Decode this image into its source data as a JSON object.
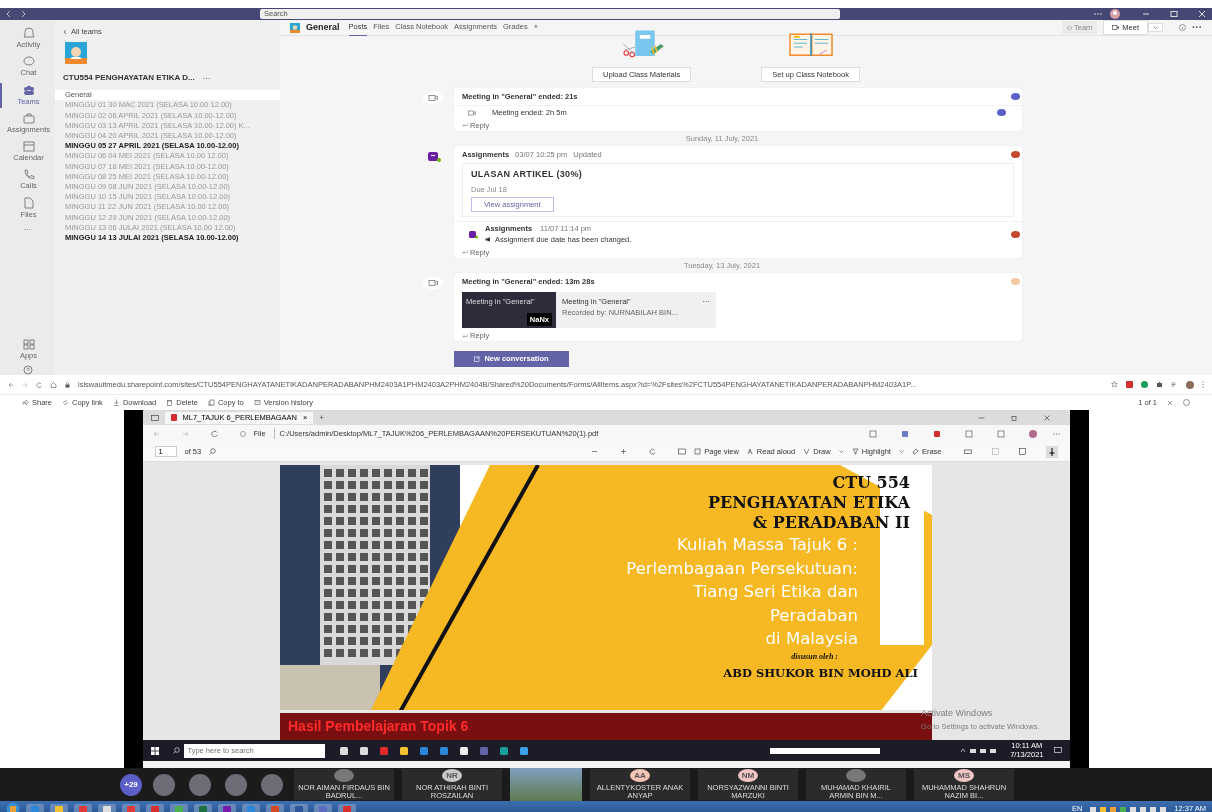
{
  "teams": {
    "search": {
      "placeholder": "Search"
    },
    "rail": [
      {
        "label": "Activity",
        "selected": false
      },
      {
        "label": "Chat",
        "selected": false
      },
      {
        "label": "Teams",
        "selected": true
      },
      {
        "label": "Assignments",
        "selected": false
      },
      {
        "label": "Calendar",
        "selected": false
      },
      {
        "label": "Calls",
        "selected": false
      },
      {
        "label": "Files",
        "selected": false
      }
    ],
    "rail_more": "···",
    "rail_bottom": [
      {
        "label": "Apps"
      }
    ],
    "back": "All teams",
    "team_name": "CTU554 PENGHAYATAN ETIKA D...",
    "team_more": "···",
    "channels": [
      {
        "name": "General",
        "selected": true,
        "unread": false
      },
      {
        "name": "MINGGU 01 30 MAC 2021 (SELASA 10.00 12.00)",
        "selected": false,
        "unread": false
      },
      {
        "name": "MINGGU 02 06 APRIL 2021 (SELASA 10.00-12.00)",
        "selected": false,
        "unread": false
      },
      {
        "name": "MINGGU 03 13 APRIL 2021 (SELASA 10.00-12.00) K...",
        "selected": false,
        "unread": false
      },
      {
        "name": "MINGGU 04 20 APRIL 2021 (SELASA 10.00-12.00)",
        "selected": false,
        "unread": false
      },
      {
        "name": "MINGGU 05 27 APRIL 2021 (SELASA 10.00-12.00)",
        "selected": false,
        "unread": true
      },
      {
        "name": "MINGGU 06 04 MEI 2021 (SELASA 10.00 12.00)",
        "selected": false,
        "unread": false
      },
      {
        "name": "MINGGU 07 18 MEI 2021 (SELASA 10.00-12.00)",
        "selected": false,
        "unread": false
      },
      {
        "name": "MINGGU 08 25 MEI 2021 (SELASA 10.00-12.00)",
        "selected": false,
        "unread": false
      },
      {
        "name": "MINGGU 09 08 JUN 2021 (SELASA 10.00-12.00)",
        "selected": false,
        "unread": false
      },
      {
        "name": "MINGGU 10 15 JUN 2021 (SELASA 10.00-12.00)",
        "selected": false,
        "unread": false
      },
      {
        "name": "MINGGU 11 22 JUN 2021 (SELASA 10.00 12.00)",
        "selected": false,
        "unread": false
      },
      {
        "name": "MINGGU 12 29 JUN 2021 (SELASA 10.00-12.00)",
        "selected": false,
        "unread": false
      },
      {
        "name": "MINGGU 13 06 JULAI 2021 (SELASA 10.00 12.00)",
        "selected": false,
        "unread": false
      },
      {
        "name": "MINGGU 14 13 JULAI 2021 (SELASA 10.00-12.00)",
        "selected": false,
        "unread": true
      }
    ],
    "channel_title": "General",
    "tabs": [
      {
        "label": "Posts",
        "selected": true
      },
      {
        "label": "Files",
        "selected": false
      },
      {
        "label": "Class Notebook",
        "selected": false
      },
      {
        "label": "Assignments",
        "selected": false
      },
      {
        "label": "Grades",
        "selected": false
      }
    ],
    "add_tab": "+",
    "team_button": "Team",
    "meet_button": "Meet",
    "header_more": "···",
    "tiles": [
      {
        "kind": "materials",
        "button": "Upload Class Materials"
      },
      {
        "kind": "notebook",
        "button": "Set up Class Notebook"
      }
    ],
    "feed": [
      {
        "kind": "meeting",
        "title": "Meeting in \"General\" ended: 21s",
        "color": "#5b5fc7",
        "replies": [
          {
            "kind": "meeting",
            "text": "Meeting ended: 2h 5m",
            "color": "#5b5fc7"
          }
        ],
        "reply": "Reply"
      },
      {
        "kind": "date",
        "text": "Sunday, 11 July, 2021"
      },
      {
        "kind": "assignment",
        "author": "Assignments",
        "time": "03/07 10:25 pm",
        "note": "Updated",
        "color": "#c4472f",
        "card": {
          "title": "ULASAN ARTIKEL (30%)",
          "due": "Due Jul 18",
          "button": "View assignment"
        },
        "replies": [
          {
            "kind": "assignment",
            "author": "Assignments",
            "time": "11/07 11:14 pm",
            "text": "Assignment due date has been changed.",
            "color": "#c4472f"
          }
        ],
        "reply": "Reply"
      },
      {
        "kind": "date",
        "text": "Tuesday, 13 July, 2021"
      },
      {
        "kind": "recording",
        "title": "Meeting in \"General\" ended: 13m 28s",
        "color": "#f4c9a0",
        "recording": {
          "thumb_title": "Meeting in \"General\"",
          "speed": "NaNx",
          "title": "Meeting in \"General\"",
          "more": "···",
          "by": "Recorded by: NURNABILAH BIN..."
        },
        "reply": "Reply"
      }
    ],
    "new_conversation": "New conversation"
  },
  "browser": {
    "url": "isiswauitmedu.sharepoint.com/sites/CTU554PENGHAYATANETIKADANPERADABANPHM2403A1PHM2403A2PHM2404B/Shared%20Documents/Forms/AllItems.aspx?id=%2Fsites%2FCTU554PENGHAYATANETIKADANPERADABANPHM2403A1P...",
    "commands": [
      {
        "label": "Share"
      },
      {
        "label": "Copy link"
      },
      {
        "label": "Download"
      },
      {
        "label": "Delete"
      },
      {
        "label": "Copy to"
      },
      {
        "label": "Version history"
      }
    ],
    "pager": "1 of 1"
  },
  "shared": {
    "tab_title": "ML7_TAJUK 6_PERLEMBAGAAN",
    "tab_close": "×",
    "new_tab": "+",
    "address_label": "File",
    "address": "C:/Users/admin/Desktop/ML7_TAJUK%206_PERLEMBAGAAN%20PERSEKUTUAN%20(1).pdf",
    "page": "1",
    "page_count": "of 53",
    "pdf_tools": [
      {
        "label": "Page view"
      },
      {
        "label": "Read aloud"
      },
      {
        "label": "Draw"
      },
      {
        "label": "Highlight"
      },
      {
        "label": "Erase"
      }
    ],
    "slide": {
      "heading": [
        "CTU 554",
        "PENGHAYATAN ETIKA",
        "& PERADABAN II"
      ],
      "subtitle": [
        "Kuliah Massa Tajuk 6 :",
        "Perlembagaan Persekutuan:",
        "Tiang Seri Etika dan",
        "Peradaban",
        "di Malaysia"
      ],
      "byline": "disusun oleh :",
      "author": "ABD SHUKOR BIN MOHD ALI"
    },
    "next_slide": "Hasil Pembelajaran Topik 6",
    "activation": [
      "Activate Windows",
      "Go to Settings to activate Windows."
    ],
    "taskbar": {
      "search": {
        "placeholder": "Type here to search"
      },
      "time": "10:11 AM",
      "date": "7/13/2021"
    }
  },
  "participants": {
    "overflow": "+29",
    "people": [
      {
        "kind": "avatar"
      },
      {
        "kind": "avatar"
      },
      {
        "kind": "avatar"
      },
      {
        "kind": "avatar"
      },
      {
        "kind": "photo",
        "name": "NOR AIMAN FIRDAUS BIN BADRUL..."
      },
      {
        "kind": "initials",
        "initials": "NR",
        "name": "NOR ATHIRAH BINTI ROSZAILAN",
        "color": "#c9c9c9"
      },
      {
        "kind": "video"
      },
      {
        "kind": "initials",
        "initials": "AA",
        "name": "ALLENTYKOSTER ANAK ANYAP",
        "color": "#f6c4b6"
      },
      {
        "kind": "initials",
        "initials": "NM",
        "name": "NORSYAZWANNI BINTI MARZUKI",
        "color": "#f2c4c8"
      },
      {
        "kind": "photo",
        "name": "MUHAMAD KHAIRIL ARMIN BIN M..."
      },
      {
        "kind": "initials",
        "initials": "MS",
        "name": "MUHAMMAD SHAHRUN NAZIM BI...",
        "color": "#f2c4c8"
      }
    ]
  },
  "os_taskbar": {
    "language": "EN",
    "time": "12:37 AM"
  }
}
